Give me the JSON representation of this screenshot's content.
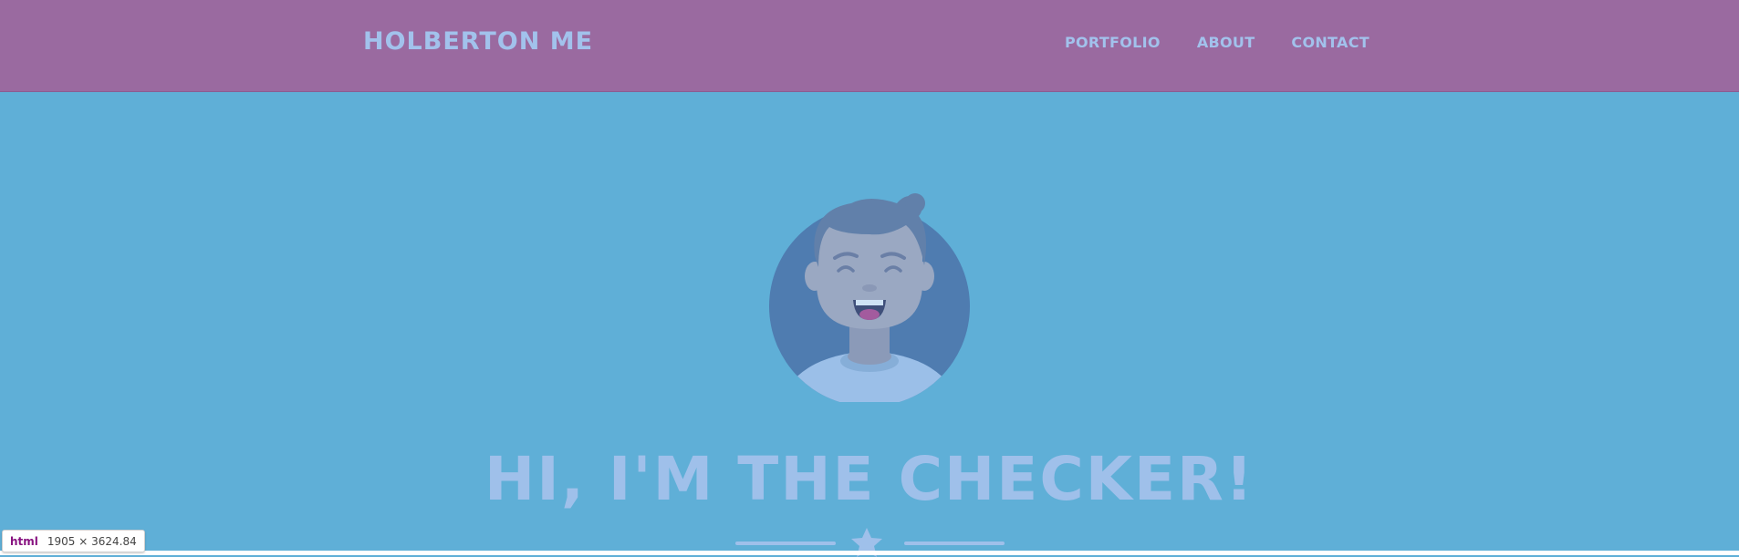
{
  "header": {
    "brand": "HOLBERTON ME",
    "nav": [
      {
        "label": "PORTFOLIO"
      },
      {
        "label": "ABOUT"
      },
      {
        "label": "CONTACT"
      }
    ]
  },
  "hero": {
    "title": "HI, I'M THE CHECKER!",
    "avatar_icon": "smiling-person-avatar",
    "divider_icon": "star-icon"
  },
  "devtools": {
    "tag": "html",
    "dimensions": "1905 × 3624.84"
  },
  "colors": {
    "navbar": "#9a6aa0",
    "background": "#5fafd7",
    "text": "#a2c2ec",
    "avatar_circle": "#4f7cb0"
  }
}
